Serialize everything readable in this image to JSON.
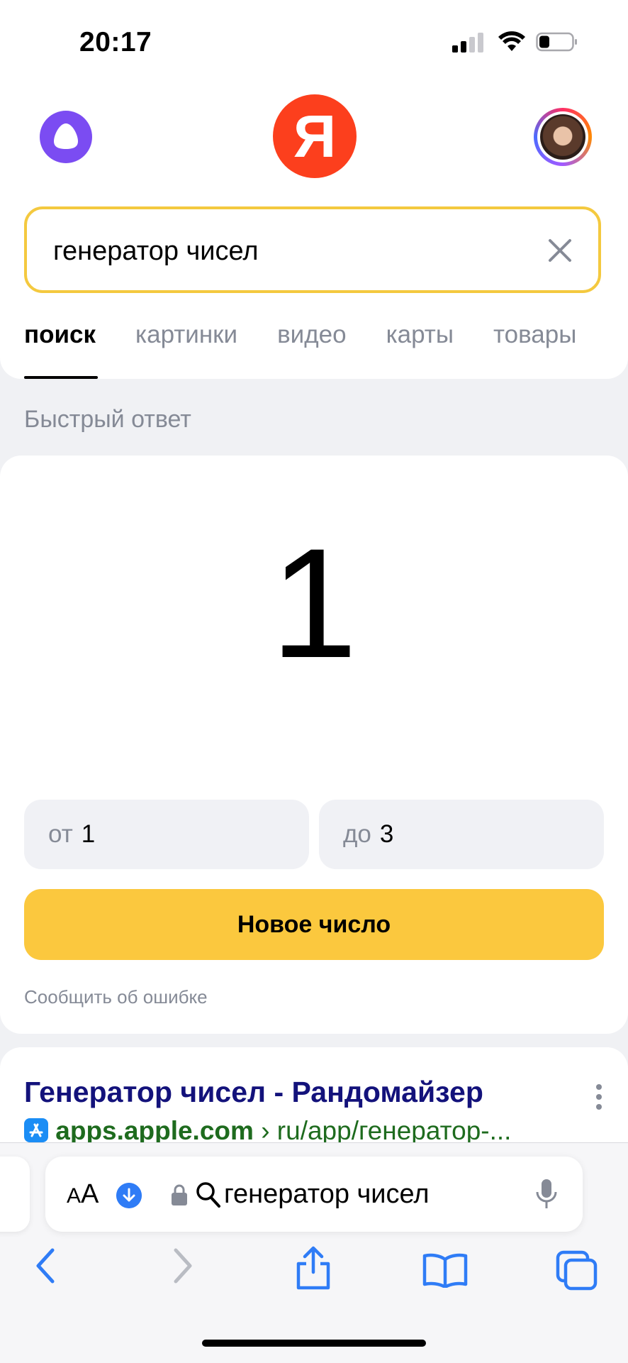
{
  "status_bar": {
    "time": "20:17"
  },
  "header": {
    "logo_letter": "Я"
  },
  "search": {
    "query": "генератор чисел"
  },
  "tabs": [
    {
      "label": "поиск",
      "active": true
    },
    {
      "label": "картинки"
    },
    {
      "label": "видео"
    },
    {
      "label": "карты"
    },
    {
      "label": "товары"
    }
  ],
  "quick_answer": {
    "section_title": "Быстрый ответ",
    "number": "1",
    "from_label": "от",
    "from_value": "1",
    "to_label": "до",
    "to_value": "3",
    "button_label": "Новое число",
    "report_label": "Сообщить об ошибке"
  },
  "result": {
    "title": "Генератор чисел - Рандомайзер",
    "domain": "apps.apple.com",
    "path": " › ru/app/генератор-..."
  },
  "safari": {
    "aa_label": "AA",
    "url_text": "генератор чисел"
  },
  "colors": {
    "yandex_red": "#fc3f1d",
    "accent_yellow": "#fbc83e",
    "search_border": "#f4c93f",
    "link_title": "#13127b",
    "link_url": "#1e6b1e",
    "ios_blue": "#2f7cf6"
  }
}
